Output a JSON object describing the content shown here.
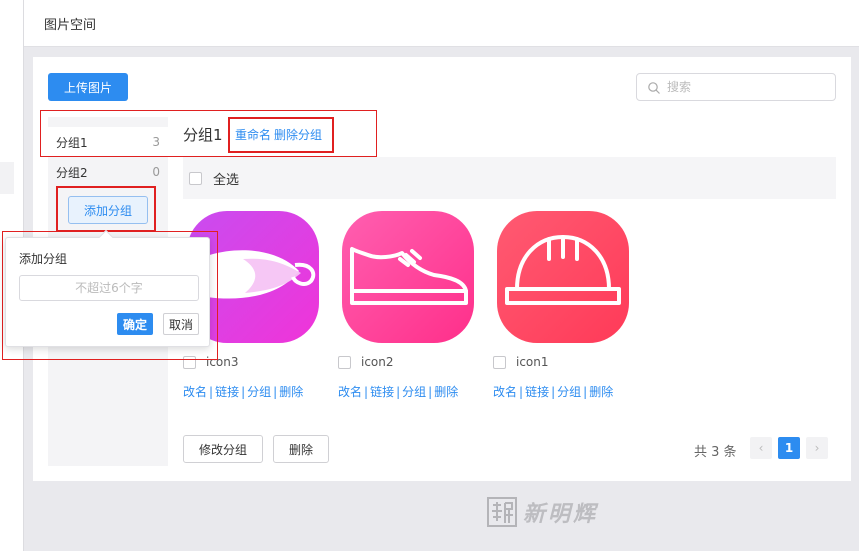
{
  "header": {
    "title": "图片空间"
  },
  "toolbar": {
    "upload_label": "上传图片"
  },
  "search": {
    "placeholder": "搜索",
    "value": ""
  },
  "sidebar": {
    "groups": [
      {
        "name": "分组1",
        "count": "3",
        "active": true
      },
      {
        "name": "分组2",
        "count": "0",
        "active": false
      }
    ],
    "add_group_label": "添加分组"
  },
  "popover": {
    "title": "添加分组",
    "input_placeholder": "不超过6个字",
    "confirm_label": "确定",
    "cancel_label": "取消"
  },
  "main": {
    "group_title": "分组1",
    "rename_label": "重命名",
    "delete_group_label": "删除分组",
    "select_all_label": "全选",
    "actions": [
      "改名",
      "链接",
      "分组",
      "删除"
    ],
    "images": [
      {
        "name": "icon3",
        "icon": "swirl-icon",
        "color": "#e040e8"
      },
      {
        "name": "icon2",
        "icon": "shoe-icon",
        "color": "#ff4aa0"
      },
      {
        "name": "icon1",
        "icon": "hard-hat-icon",
        "color": "#ff5068"
      }
    ],
    "modify_group_label": "修改分组",
    "delete_label": "删除"
  },
  "pagination": {
    "total_text": "共 3 条",
    "current_page": "1",
    "prev_icon": "‹",
    "next_icon": "›"
  },
  "watermark": {
    "text": "新明辉"
  },
  "colors": {
    "accent": "#2d8cf0",
    "highlight_box": "#e02020"
  }
}
